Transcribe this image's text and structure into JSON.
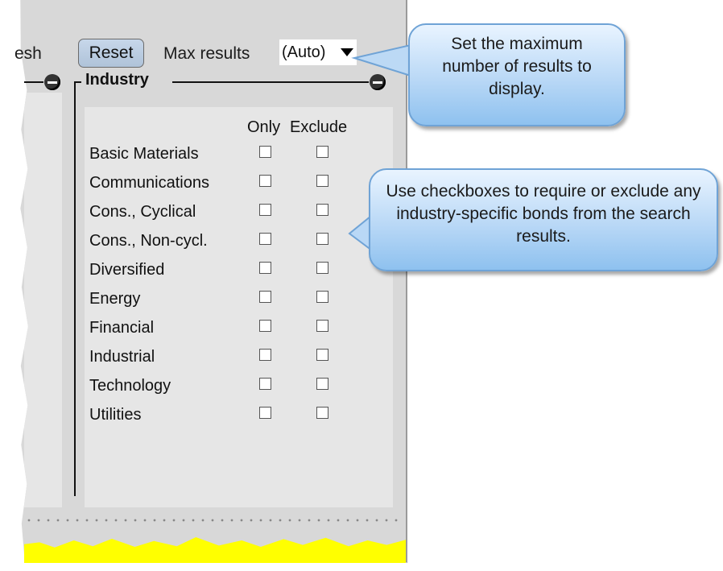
{
  "toolbar": {
    "refresh_fragment": "esh",
    "reset_label": "Reset",
    "max_results_label": "Max results",
    "max_results_value": "(Auto)"
  },
  "industry": {
    "title": "Industry",
    "col_only": "Only",
    "col_exclude": "Exclude",
    "rows": [
      {
        "label": "Basic Materials"
      },
      {
        "label": "Communications"
      },
      {
        "label": "Cons., Cyclical"
      },
      {
        "label": "Cons., Non-cycl."
      },
      {
        "label": "Diversified"
      },
      {
        "label": "Energy"
      },
      {
        "label": "Financial"
      },
      {
        "label": "Industrial"
      },
      {
        "label": "Technology"
      },
      {
        "label": "Utilities"
      }
    ]
  },
  "callouts": {
    "max_results": "Set the maximum number of results to display.",
    "industry": "Use checkboxes to require or exclude any industry-specific bonds from the search results."
  },
  "colors": {
    "callout_fill": "#b9d8f6",
    "callout_border": "#6fa3d6",
    "highlight": "#ffff00",
    "reset_button": "#c1d2e6"
  }
}
